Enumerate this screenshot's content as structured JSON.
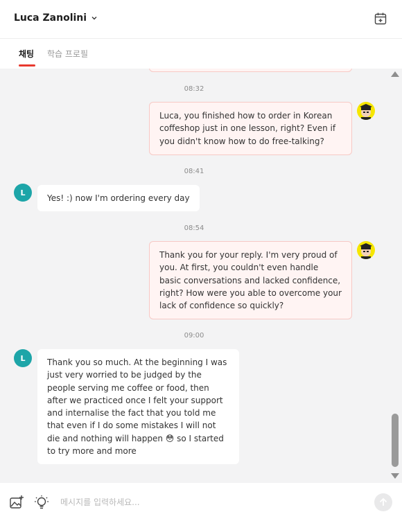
{
  "header": {
    "user_name": "Luca Zanolini"
  },
  "tabs": [
    {
      "label": "채팅",
      "active": true
    },
    {
      "label": "학습 프로필",
      "active": false
    }
  ],
  "messages": [
    {
      "time": "08:32",
      "from": "tutor",
      "text": "Luca, you finished how to order in Korean coffeshop just in one lesson, right? Even if you didn't know how to do free-talking?"
    },
    {
      "time": "08:41",
      "from": "student",
      "avatar_letter": "L",
      "text": "Yes! :) now I'm ordering every day"
    },
    {
      "time": "08:54",
      "from": "tutor",
      "text": "Thank you for your reply. I'm very proud of you. At first, you couldn't even handle basic conversations and lacked confidence, right? How were you able to overcome your lack of confidence so quickly?"
    },
    {
      "time": "09:00",
      "from": "student",
      "avatar_letter": "L",
      "text": "Thank you so much. At the beginning I was just very worried to be judged by the people serving me coffee or food, then after we practiced once I felt your support and internalise the fact that you told me that even if I do some mistakes I will not die and nothing will happen 😳 so I started to try more and more"
    }
  ],
  "input": {
    "placeholder": "메시지를 입력하세요..."
  },
  "colors": {
    "accent": "#e8392e",
    "student_avatar": "#1da5a8",
    "tutor_bubble": "#fff4f3",
    "tutor_avatar_bg": "#f6e600"
  },
  "icons": {
    "header_right": "calendar-add-icon",
    "input_left_1": "image-add-icon",
    "input_left_2": "lightbulb-icon",
    "send": "arrow-up-icon"
  }
}
